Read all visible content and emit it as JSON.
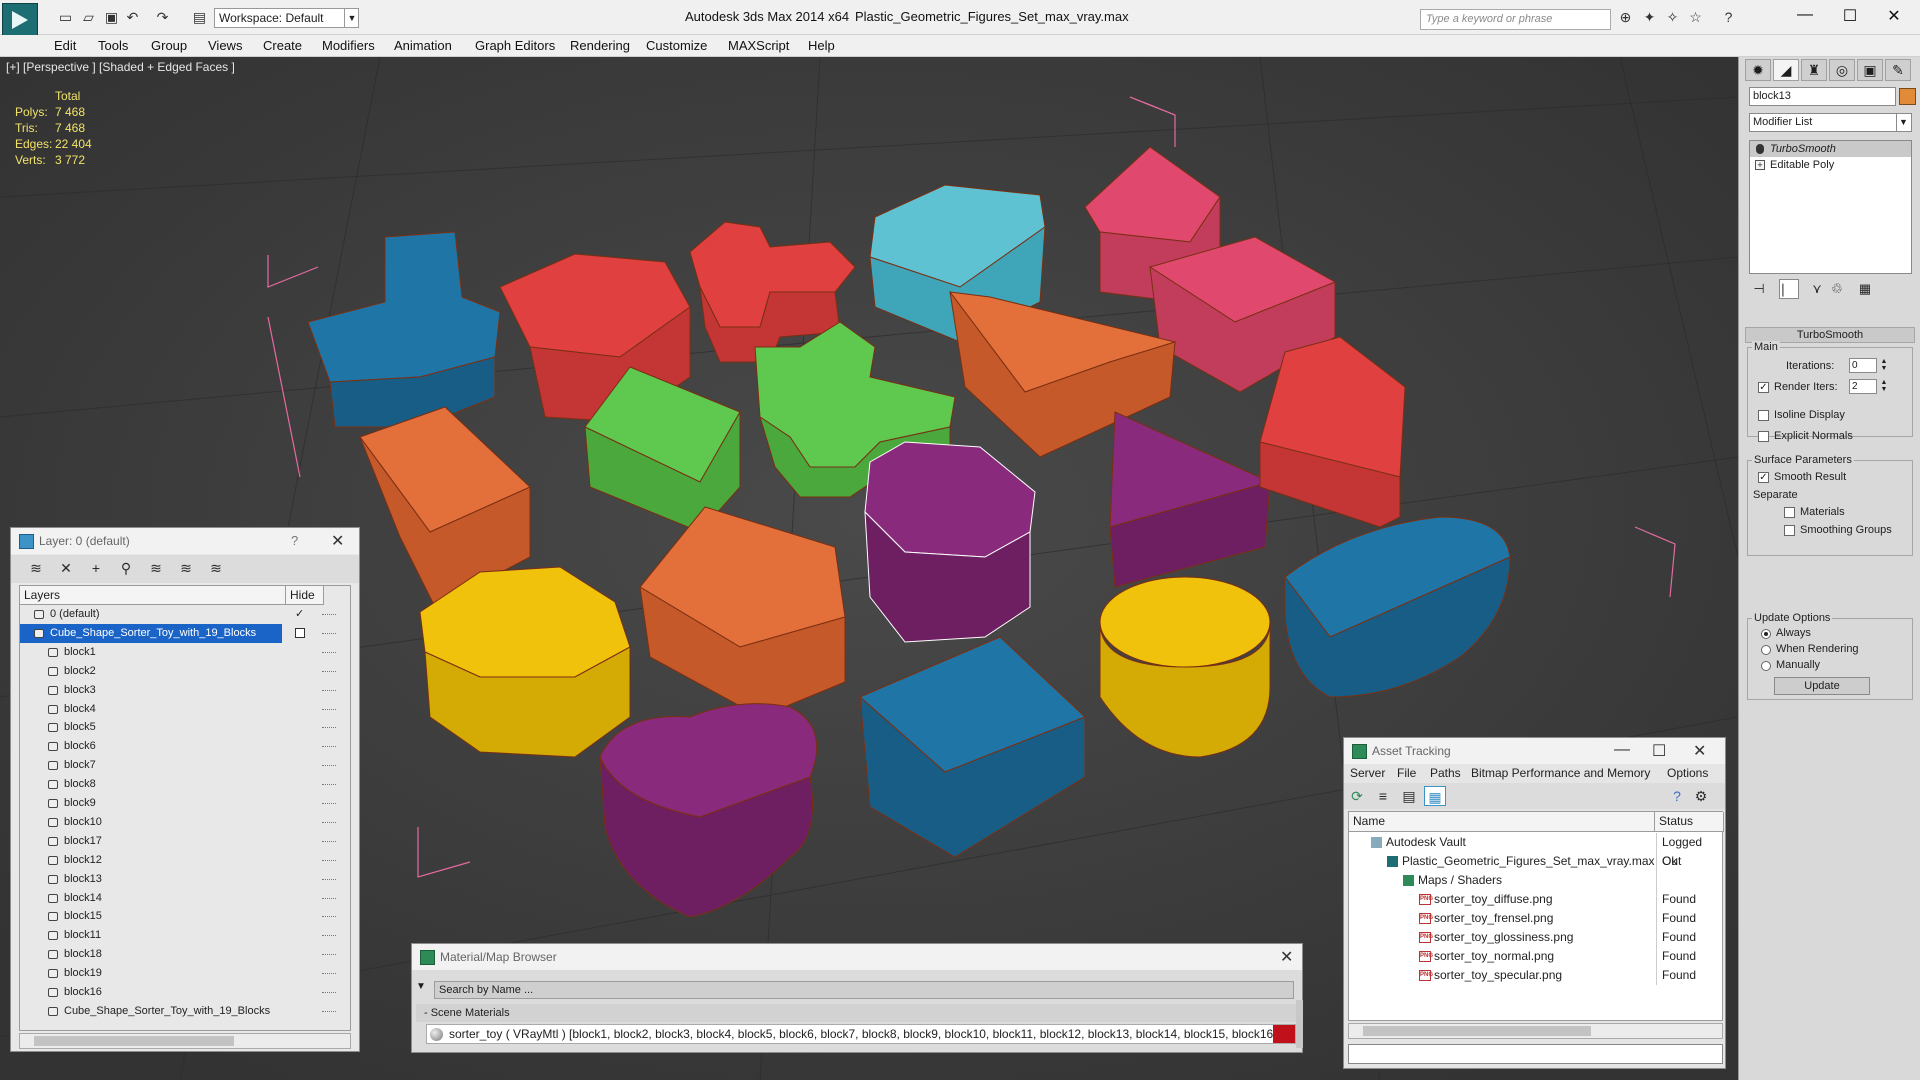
{
  "titlebar": {
    "workspace": "Workspace: Default",
    "app_title": "Autodesk 3ds Max  2014 x64",
    "file_title": "Plastic_Geometric_Figures_Set_max_vray.max",
    "search_placeholder": "Type a keyword or phrase"
  },
  "menu": [
    "Edit",
    "Tools",
    "Group",
    "Views",
    "Create",
    "Modifiers",
    "Animation",
    "Graph Editors",
    "Rendering",
    "Customize",
    "MAXScript",
    "Help"
  ],
  "viewport": {
    "label": "[+] [Perspective ] [Shaded + Edged Faces ]",
    "stats": {
      "header": "Total",
      "labels": [
        "Polys:",
        "Tris:",
        "Edges:",
        "Verts:"
      ],
      "values": [
        "7 468",
        "7 468",
        "22 404",
        "3 772"
      ]
    }
  },
  "command_panel": {
    "object_name": "block13",
    "object_color": "#e18a37",
    "modifier_list": "Modifier List",
    "stack": [
      "TurboSmooth",
      "Editable Poly"
    ],
    "rollout_title": "TurboSmooth",
    "main_label": "Main",
    "iterations_label": "Iterations:",
    "iterations_value": "0",
    "render_iters_label": "Render Iters:",
    "render_iters_value": "2",
    "isoline_label": "Isoline Display",
    "explicit_label": "Explicit Normals",
    "surface_label": "Surface Parameters",
    "smooth_label": "Smooth Result",
    "separate_label": "Separate",
    "materials_label": "Materials",
    "smoothing_label": "Smoothing Groups",
    "update_options_label": "Update Options",
    "always_label": "Always",
    "when_rendering_label": "When Rendering",
    "manually_label": "Manually",
    "update_button": "Update"
  },
  "layer_panel": {
    "title": "Layer: 0 (default)",
    "help": "?",
    "col_layers": "Layers",
    "col_hide": "Hide",
    "rows": [
      "0 (default)",
      "Cube_Shape_Sorter_Toy_with_19_Blocks",
      "block1",
      "block2",
      "block3",
      "block4",
      "block5",
      "block6",
      "block7",
      "block8",
      "block9",
      "block10",
      "block17",
      "block12",
      "block13",
      "block14",
      "block15",
      "block11",
      "block18",
      "block19",
      "block16",
      "Cube_Shape_Sorter_Toy_with_19_Blocks"
    ]
  },
  "asset_tracking": {
    "title": "Asset Tracking",
    "menu": [
      "Server",
      "File",
      "Paths",
      "Bitmap Performance and Memory",
      "Options"
    ],
    "col_name": "Name",
    "col_status": "Status",
    "rows": [
      {
        "name": "Autodesk Vault",
        "status": "Logged Out"
      },
      {
        "name": "Plastic_Geometric_Figures_Set_max_vray.max",
        "status": "Ok"
      },
      {
        "name": "Maps / Shaders",
        "status": ""
      },
      {
        "name": "sorter_toy_diffuse.png",
        "status": "Found"
      },
      {
        "name": "sorter_toy_frensel.png",
        "status": "Found"
      },
      {
        "name": "sorter_toy_glossiness.png",
        "status": "Found"
      },
      {
        "name": "sorter_toy_normal.png",
        "status": "Found"
      },
      {
        "name": "sorter_toy_specular.png",
        "status": "Found"
      }
    ]
  },
  "material_browser": {
    "title": "Material/Map Browser",
    "search": "Search by Name ...",
    "section": "- Scene Materials",
    "item": "sorter_toy  ( VRayMtl ) [block1, block2, block3, block4, block5, block6, block7, block8, block9, block10, block11, block12, block13, block14, block15, block16, block..."
  }
}
